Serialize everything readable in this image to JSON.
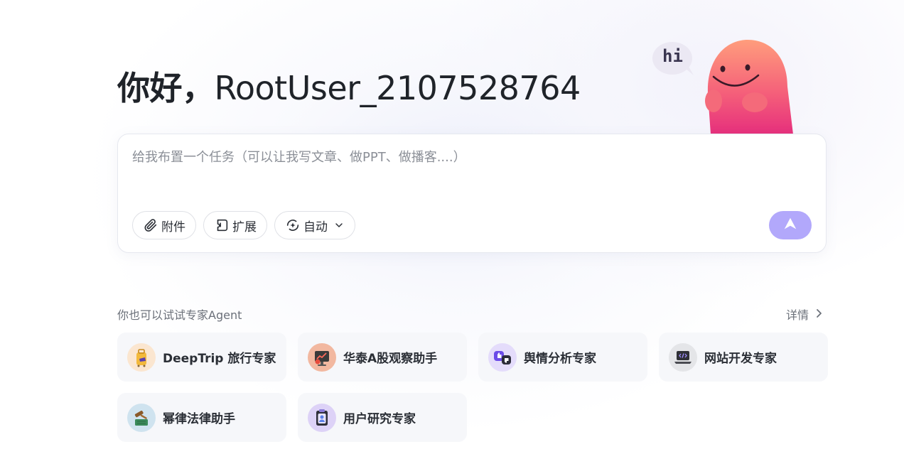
{
  "greeting": {
    "prefix": "你好，",
    "username": "RootUser_2107528764"
  },
  "mascot": {
    "bubble_text": "hi"
  },
  "composer": {
    "placeholder": "给我布置一个任务（可以让我写文章、做PPT、做播客....）",
    "value": "",
    "attach_label": "附件",
    "extend_label": "扩展",
    "auto_label": "自动"
  },
  "section": {
    "label": "你也可以试试专家Agent",
    "details_label": "详情"
  },
  "agents": [
    {
      "label": "DeepTrip 旅行专家",
      "icon": "luggage-icon"
    },
    {
      "label": "华泰A股观察助手",
      "icon": "stock-chart-icon"
    },
    {
      "label": "舆情分析专家",
      "icon": "thumbs-icon"
    },
    {
      "label": "网站开发专家",
      "icon": "laptop-code-icon"
    },
    {
      "label": "幂律法律助手",
      "icon": "gavel-icon"
    },
    {
      "label": "用户研究专家",
      "icon": "user-clipboard-icon"
    }
  ],
  "colors": {
    "send_button": "#b2a8fb",
    "card_bg": "#f6f7fa",
    "mascot_top": "#ff9a7a",
    "mascot_bottom": "#e8307a"
  }
}
